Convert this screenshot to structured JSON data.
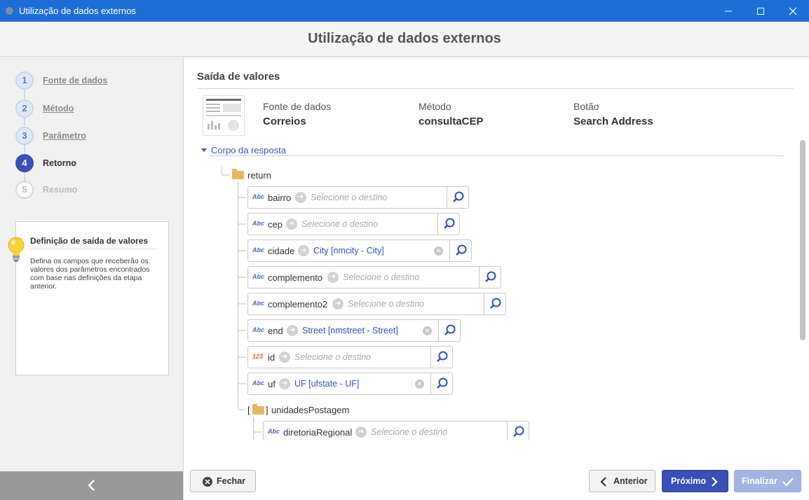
{
  "window": {
    "title": "Utilização de dados externos",
    "min_glyph": "—",
    "max_glyph": "☐",
    "close_glyph": "✕"
  },
  "header": {
    "title": "Utilização de dados externos"
  },
  "steps": [
    {
      "num": "1",
      "label": "Fonte de dados",
      "state": "done"
    },
    {
      "num": "2",
      "label": "Método",
      "state": "done"
    },
    {
      "num": "3",
      "label": "Parâmetro",
      "state": "done"
    },
    {
      "num": "4",
      "label": "Retorno",
      "state": "active"
    },
    {
      "num": "5",
      "label": "Resumo",
      "state": "disabled"
    }
  ],
  "info": {
    "title": "Definição de saída de valores",
    "text": "Defina os campos que receberão os valores dos parâmetros encontrados com base nas definições da etapa anterior."
  },
  "section": {
    "title": "Saída de valores"
  },
  "summary": {
    "source_label": "Fonte de dados",
    "source_value": "Correios",
    "method_label": "Método",
    "method_value": "consultaCEP",
    "button_label": "Botão",
    "button_value": "Search Address"
  },
  "body": {
    "toggle_label": "Corpo da resposta",
    "root": "return",
    "fields": [
      {
        "type": "Abc",
        "name": "bairro",
        "dest": "Selecione o destino",
        "filled": false
      },
      {
        "type": "Abc",
        "name": "cep",
        "dest": "Selecione o destino",
        "filled": false
      },
      {
        "type": "Abc",
        "name": "cidade",
        "dest": "City [nmcity - City]",
        "filled": true
      },
      {
        "type": "Abc",
        "name": "complemento",
        "dest": "Selecione o destino",
        "filled": false
      },
      {
        "type": "Abc",
        "name": "complemento2",
        "dest": "Selecione o destino",
        "filled": false
      },
      {
        "type": "Abc",
        "name": "end",
        "dest": "Street [nmstreet - Street]",
        "filled": true
      },
      {
        "type": "123",
        "name": "id",
        "dest": "Selecione o destino",
        "filled": false
      },
      {
        "type": "Abc",
        "name": "uf",
        "dest": "UF [ufstate - UF]",
        "filled": true
      }
    ],
    "array_open": "[",
    "array_close": "]",
    "array_name": "unidadesPostagem",
    "array_fields": [
      {
        "type": "Abc",
        "name": "diretoriaRegional",
        "dest": "Selecione o destino",
        "filled": false
      }
    ]
  },
  "buttons": {
    "close": "Fechar",
    "previous": "Anterior",
    "next": "Próximo",
    "finish": "Finalizar"
  },
  "icons": {
    "close_circle": "⊗",
    "chevron_left": "‹",
    "chevron_right": "›",
    "check": "✓",
    "collapse": "‹"
  },
  "colors": {
    "titlebar": "#1d6fd6",
    "primary": "#3a4fb8",
    "primary_disabled": "#a4b4e2",
    "link": "#3b59b6",
    "folder": "#e8b764"
  }
}
